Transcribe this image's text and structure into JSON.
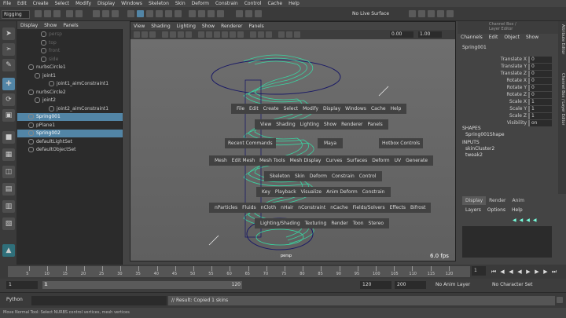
{
  "menubar": [
    "File",
    "Edit",
    "Create",
    "Select",
    "Modify",
    "Display",
    "Windows",
    "Skeleton",
    "Skin",
    "Deform",
    "Constrain",
    "Control",
    "Cache",
    "Help"
  ],
  "status": {
    "mode": "Rigging",
    "no_live_surface": "No Live Surface"
  },
  "outliner": {
    "menu": [
      "Display",
      "Show",
      "Panels"
    ],
    "rows": [
      {
        "label": "persp",
        "dim": true
      },
      {
        "label": "top",
        "dim": true
      },
      {
        "label": "front",
        "dim": true
      },
      {
        "label": "side",
        "dim": true
      },
      {
        "label": "nurbsCircle1"
      },
      {
        "label": "joint1"
      },
      {
        "label": "joint1_aimConstraint1"
      },
      {
        "label": "nurbsCircle2"
      },
      {
        "label": "joint2"
      },
      {
        "label": "joint2_aimConstraint1"
      },
      {
        "label": "Spring001",
        "selected": true
      },
      {
        "label": "pPlane1"
      },
      {
        "label": "Spring002",
        "selected": true
      },
      {
        "label": "defaultLightSet"
      },
      {
        "label": "defaultObjectSet"
      }
    ]
  },
  "viewport": {
    "menu": [
      "View",
      "Shading",
      "Lighting",
      "Show",
      "Renderer",
      "Panels"
    ],
    "toolbar_values": [
      "0.00",
      "1.00"
    ],
    "camera": "persp",
    "fps": "6.0 fps"
  },
  "hotbox": {
    "row1": [
      "File",
      "Edit",
      "Create",
      "Select",
      "Modify",
      "Display",
      "Windows",
      "Cache",
      "Help"
    ],
    "row2": [
      "View",
      "Shading",
      "Lighting",
      "Show",
      "Renderer",
      "Panels"
    ],
    "recent": "Recent Commands",
    "maya": "Maya",
    "hotbox_controls": "Hotbox Controls",
    "row3": [
      "Mesh",
      "Edit Mesh",
      "Mesh Tools",
      "Mesh Display",
      "Curves",
      "Surfaces",
      "Deform",
      "UV",
      "Generate"
    ],
    "row4": [
      "Skeleton",
      "Skin",
      "Deform",
      "Constrain",
      "Control"
    ],
    "row5": [
      "Key",
      "Playback",
      "Visualize",
      "Anim Deform",
      "Constrain"
    ],
    "row6": [
      "nParticles",
      "Fluids",
      "nCloth",
      "nHair",
      "nConstraint",
      "nCache",
      "Fields/Solvers",
      "Effects",
      "Bifrost"
    ],
    "row7": [
      "Lighting/Shading",
      "Texturing",
      "Render",
      "Toon",
      "Stereo"
    ]
  },
  "channelbox": {
    "header": "Channel Box / Layer Editor",
    "menu": [
      "Channels",
      "Edit",
      "Object",
      "Show"
    ],
    "object": "Spring001",
    "attrs": [
      {
        "name": "Translate X",
        "value": "0"
      },
      {
        "name": "Translate Y",
        "value": "0"
      },
      {
        "name": "Translate Z",
        "value": "0"
      },
      {
        "name": "Rotate X",
        "value": "0"
      },
      {
        "name": "Rotate Y",
        "value": "0"
      },
      {
        "name": "Rotate Z",
        "value": "0"
      },
      {
        "name": "Scale X",
        "value": "1"
      },
      {
        "name": "Scale Y",
        "value": "1"
      },
      {
        "name": "Scale Z",
        "value": "1"
      },
      {
        "name": "Visibility",
        "value": "on"
      }
    ],
    "shapes_label": "SHAPES",
    "shape": "Spring001Shape",
    "inputs_label": "INPUTS",
    "inputs": [
      "skinCluster2",
      "tweak2"
    ],
    "side_tabs": [
      "Attribute Editor",
      "Channel Box / Layer Editor"
    ]
  },
  "layer_editor": {
    "tabs": [
      "Display",
      "Render",
      "Anim"
    ],
    "menu": [
      "Layers",
      "Options",
      "Help"
    ]
  },
  "timeslider": {
    "ticks": [
      "5",
      "10",
      "15",
      "20",
      "25",
      "30",
      "35",
      "40",
      "45",
      "50",
      "55",
      "60",
      "65",
      "70",
      "75",
      "80",
      "85",
      "90",
      "95",
      "100",
      "105",
      "110",
      "115",
      "120"
    ],
    "current": "1"
  },
  "rangeslider": {
    "start": "1",
    "playback_start": "1",
    "range_start": "1",
    "range_end": "120",
    "playback_end": "120",
    "end": "200",
    "anim_layer": "No Anim Layer",
    "character_set": "No Character Set"
  },
  "cmdline": {
    "language": "Python",
    "result": "// Result: Copied 1 skins"
  },
  "helpline": "Move Normal Tool: Select NURBS control vertices, mesh vertices"
}
